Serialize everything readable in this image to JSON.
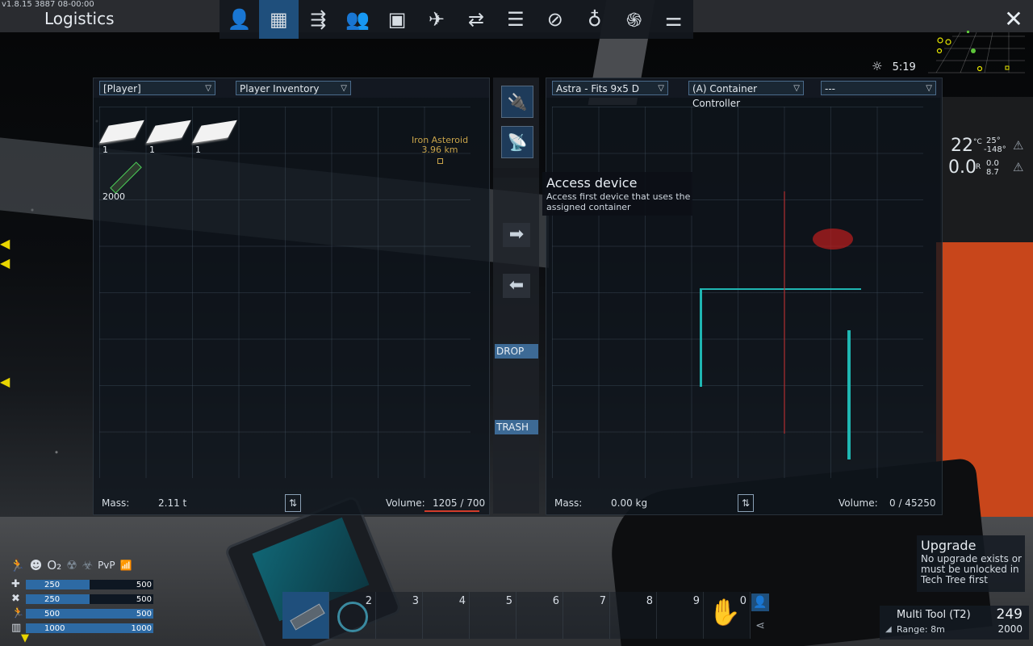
{
  "version": "v1.8.15 3887 08-00:00",
  "screen_title": "Logistics",
  "top_tabs": [
    {
      "icon": "player-icon",
      "glyph": "👤"
    },
    {
      "icon": "logistics-icon",
      "glyph": "▦"
    },
    {
      "icon": "network-icon",
      "glyph": "⇶"
    },
    {
      "icon": "faction-icon",
      "glyph": "👥"
    },
    {
      "icon": "window-icon",
      "glyph": "▣"
    },
    {
      "icon": "ship-icon",
      "glyph": "✈"
    },
    {
      "icon": "exchange-icon",
      "glyph": "⇄"
    },
    {
      "icon": "list-icon",
      "glyph": "☰"
    },
    {
      "icon": "compass-icon",
      "glyph": "⊘"
    },
    {
      "icon": "planet-icon",
      "glyph": "♁"
    },
    {
      "icon": "galaxy-icon",
      "glyph": "֍"
    },
    {
      "icon": "settings-sliders-icon",
      "glyph": "⚌"
    }
  ],
  "close_glyph": "✕",
  "clock": "5:19",
  "weather": {
    "temp": "22",
    "temp_unit": "°C",
    "temp_hi": "25°",
    "temp_lo": "-148°",
    "rad": "0.0",
    "rad_unit": "R",
    "rad_a": "0.0",
    "rad_b": "8.7"
  },
  "left_panel": {
    "dropdown1": "[Player]",
    "dropdown2": "Player Inventory",
    "items": [
      {
        "kind": "plate",
        "qty": "1"
      },
      {
        "kind": "plate",
        "qty": "1"
      },
      {
        "kind": "plate",
        "qty": "1"
      },
      {
        "kind": "tool",
        "qty": "2000"
      }
    ],
    "mass_label": "Mass:",
    "mass_value": "2.11 t",
    "volume_label": "Volume:",
    "volume_value": "1205 / 700"
  },
  "waypoint": {
    "name": "Iron Asteroid",
    "distance": "3.96 km"
  },
  "middle": {
    "drop_label": "DROP",
    "trash_label": "TRASH"
  },
  "tooltip": {
    "title": "Access device",
    "body": "Access first device that uses the assigned container"
  },
  "right_panel": {
    "dropdown1": "Astra - Fits 9x5 D",
    "dropdown2": "(A) Container Controller",
    "dropdown3": "---",
    "mass_label": "Mass:",
    "mass_value": "0.00 kg",
    "volume_label": "Volume:",
    "volume_value": "0 / 45250"
  },
  "stats": [
    {
      "icon": "health-icon",
      "glyph": "✚",
      "current": "250",
      "max": "500",
      "fraction": 0.5
    },
    {
      "icon": "food-icon",
      "glyph": "✖",
      "current": "250",
      "max": "500",
      "fraction": 0.5
    },
    {
      "icon": "stamina-icon",
      "glyph": "🏃",
      "current": "500",
      "max": "500",
      "fraction": 1.0
    },
    {
      "icon": "oxygen-tank-icon",
      "glyph": "▥",
      "current": "1000",
      "max": "1000",
      "fraction": 1.0
    }
  ],
  "status_icons": [
    "🏃",
    "☻",
    "O₂",
    "☢",
    "☣",
    "PvP",
    "📶"
  ],
  "hotbar": [
    "",
    "2",
    "3",
    "4",
    "5",
    "6",
    "7",
    "8",
    "9",
    "0"
  ],
  "upgrade": {
    "title": "Upgrade",
    "body": "No upgrade exists or must be unlocked in Tech Tree first"
  },
  "tool": {
    "name": "Multi Tool (T2)",
    "range": "Range: 8m",
    "count": "249",
    "max": "2000"
  }
}
